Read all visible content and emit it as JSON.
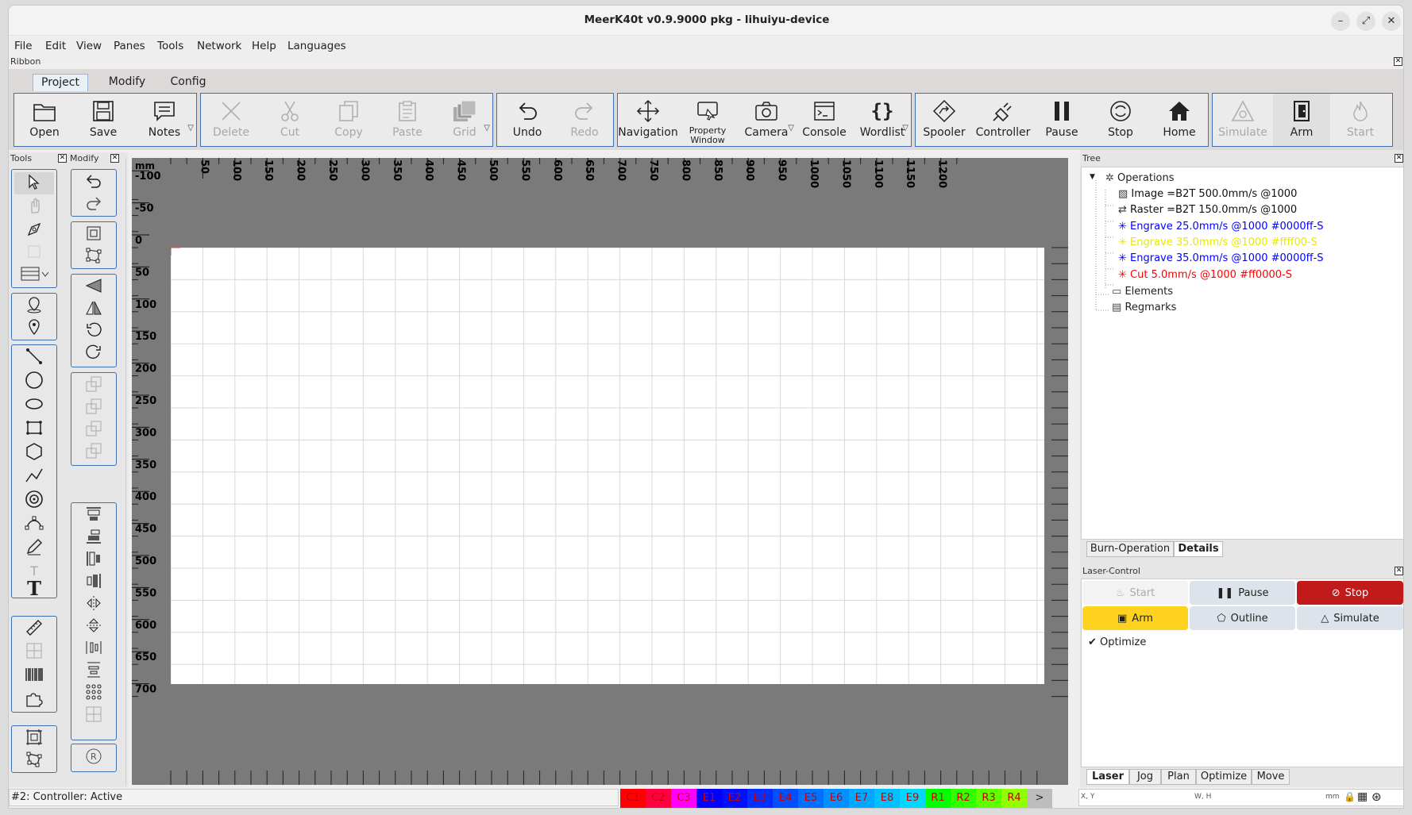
{
  "title": "MeerK40t v0.9.9000 pkg - lihuiyu-device",
  "window_buttons": [
    "–",
    "⤢",
    "✕"
  ],
  "menu": [
    "File",
    "Edit",
    "View",
    "Panes",
    "Tools",
    "Network",
    "Help",
    "Languages"
  ],
  "ribbon_label": "Ribbon",
  "tabs": [
    "Project",
    "Modify",
    "Config"
  ],
  "ribbon": {
    "g1": [
      "Open",
      "Save",
      "Notes"
    ],
    "g2": [
      "Delete",
      "Cut",
      "Copy",
      "Paste",
      "Grid"
    ],
    "g3": [
      "Undo",
      "Redo"
    ],
    "g4": [
      "Navigation",
      "Property Window",
      "Camera",
      "Console",
      "Wordlist"
    ],
    "g5": [
      "Spooler",
      "Controller",
      "Pause",
      "Stop",
      "Home"
    ],
    "g6": [
      "Simulate",
      "Arm",
      "Start"
    ]
  },
  "panes": {
    "tools": "Tools",
    "modify": "Modify",
    "tree": "Tree",
    "laser": "Laser-Control"
  },
  "ruler": {
    "unit": "mm",
    "top": [
      "50",
      "100",
      "150",
      "200",
      "250",
      "300",
      "350",
      "400",
      "450",
      "500",
      "550",
      "600",
      "650",
      "700",
      "750",
      "800",
      "850",
      "900",
      "950",
      "1000",
      "1050",
      "1100",
      "1150",
      "1200"
    ],
    "left": [
      "-100",
      "-50",
      "0",
      "50",
      "100",
      "150",
      "200",
      "250",
      "300",
      "350",
      "400",
      "450",
      "500",
      "550",
      "600",
      "650",
      "700"
    ]
  },
  "tree": {
    "root": "Operations",
    "ops": [
      {
        "text": "Image =B2T 500.0mm/s @1000",
        "color": "#111111"
      },
      {
        "text": "Raster =B2T 150.0mm/s @1000",
        "color": "#111111"
      },
      {
        "text": "Engrave 25.0mm/s @1000 #0000ff-S",
        "color": "#0000ff"
      },
      {
        "text": "Engrave 35.0mm/s @1000 #ffff00-S",
        "color": "#e8e800"
      },
      {
        "text": "Engrave 35.0mm/s @1000 #0000ff-S",
        "color": "#0000ff"
      },
      {
        "text": "Cut 5.0mm/s @1000 #ff0000-S",
        "color": "#ff0000"
      }
    ],
    "elements": "Elements",
    "regmarks": "Regmarks"
  },
  "tree_tabs": [
    "Burn-Operation",
    "Details"
  ],
  "laser": {
    "start": "Start",
    "pause": "Pause",
    "stop": "Stop",
    "arm": "Arm",
    "outline": "Outline",
    "simulate": "Simulate",
    "optimize": "Optimize"
  },
  "laser_tabs": [
    "Laser",
    "Jog",
    "Plan",
    "Optimize",
    "Move"
  ],
  "status": {
    "text": "#2: Controller: Active",
    "chips": [
      {
        "label": "C1",
        "bg": "#ff0000"
      },
      {
        "label": "C2",
        "bg": "#ff0040"
      },
      {
        "label": "C3",
        "bg": "#ff00ff"
      },
      {
        "label": "E1",
        "bg": "#0000ff"
      },
      {
        "label": "E2",
        "bg": "#0010ff"
      },
      {
        "label": "E3",
        "bg": "#0030ff"
      },
      {
        "label": "E4",
        "bg": "#0050ff"
      },
      {
        "label": "E5",
        "bg": "#0070ff"
      },
      {
        "label": "E6",
        "bg": "#0090ff"
      },
      {
        "label": "E7",
        "bg": "#00a8ff"
      },
      {
        "label": "E8",
        "bg": "#00c0ff"
      },
      {
        "label": "E9",
        "bg": "#00d8ff"
      },
      {
        "label": "R1",
        "bg": "#00ff00"
      },
      {
        "label": "R2",
        "bg": "#30ff00"
      },
      {
        "label": "R3",
        "bg": "#60ff00"
      },
      {
        "label": "R4",
        "bg": "#90ff00"
      },
      {
        "label": ">",
        "bg": "#bdbdbd"
      }
    ],
    "xy": "X, Y",
    "wh": "W, H",
    "unit": "mm"
  }
}
